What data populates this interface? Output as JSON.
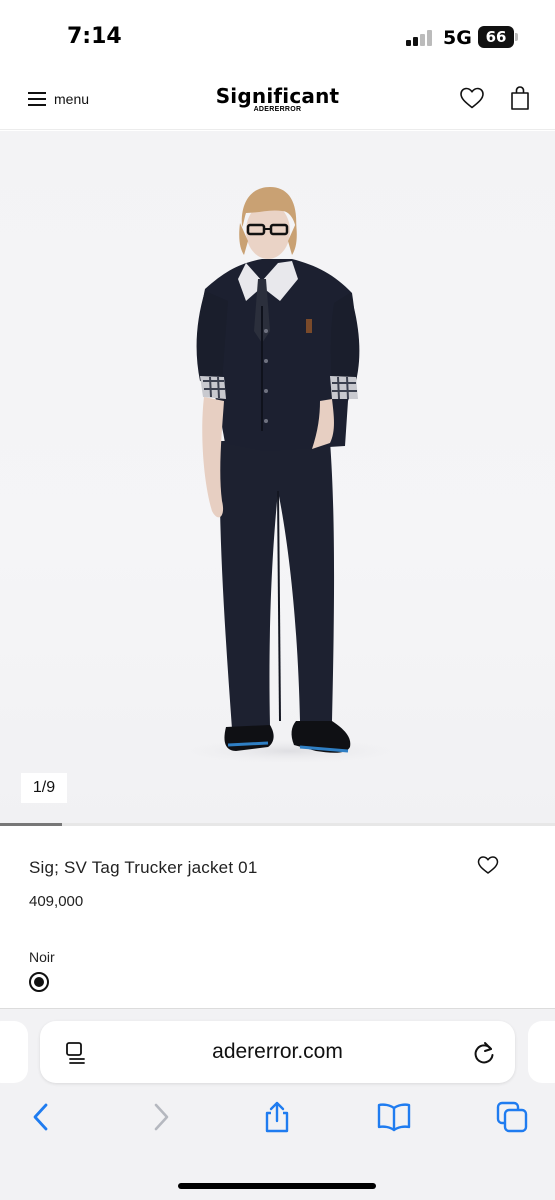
{
  "status_bar": {
    "time": "7:14",
    "network": "5G",
    "battery": "66"
  },
  "header": {
    "menu_label": "menu",
    "brand_name": "Significant",
    "brand_sub": "ADERERROR",
    "wishlist_icon": "heart-outline-icon",
    "bag_icon": "shopping-bag-icon"
  },
  "gallery": {
    "counter": "1/9",
    "current": 1,
    "total": 9
  },
  "product": {
    "title": "Sig; SV Tag Trucker jacket 01",
    "price": "409,000",
    "color_name": "Noir"
  },
  "browser": {
    "url": "adererror.com",
    "icons": [
      "page-menu-icon",
      "reload-icon",
      "back-icon",
      "forward-icon",
      "share-icon",
      "bookmarks-icon",
      "tabs-icon"
    ]
  },
  "colors": {
    "accent_blue": "#1f7cf0",
    "disabled_gray": "#b5b8bf"
  }
}
